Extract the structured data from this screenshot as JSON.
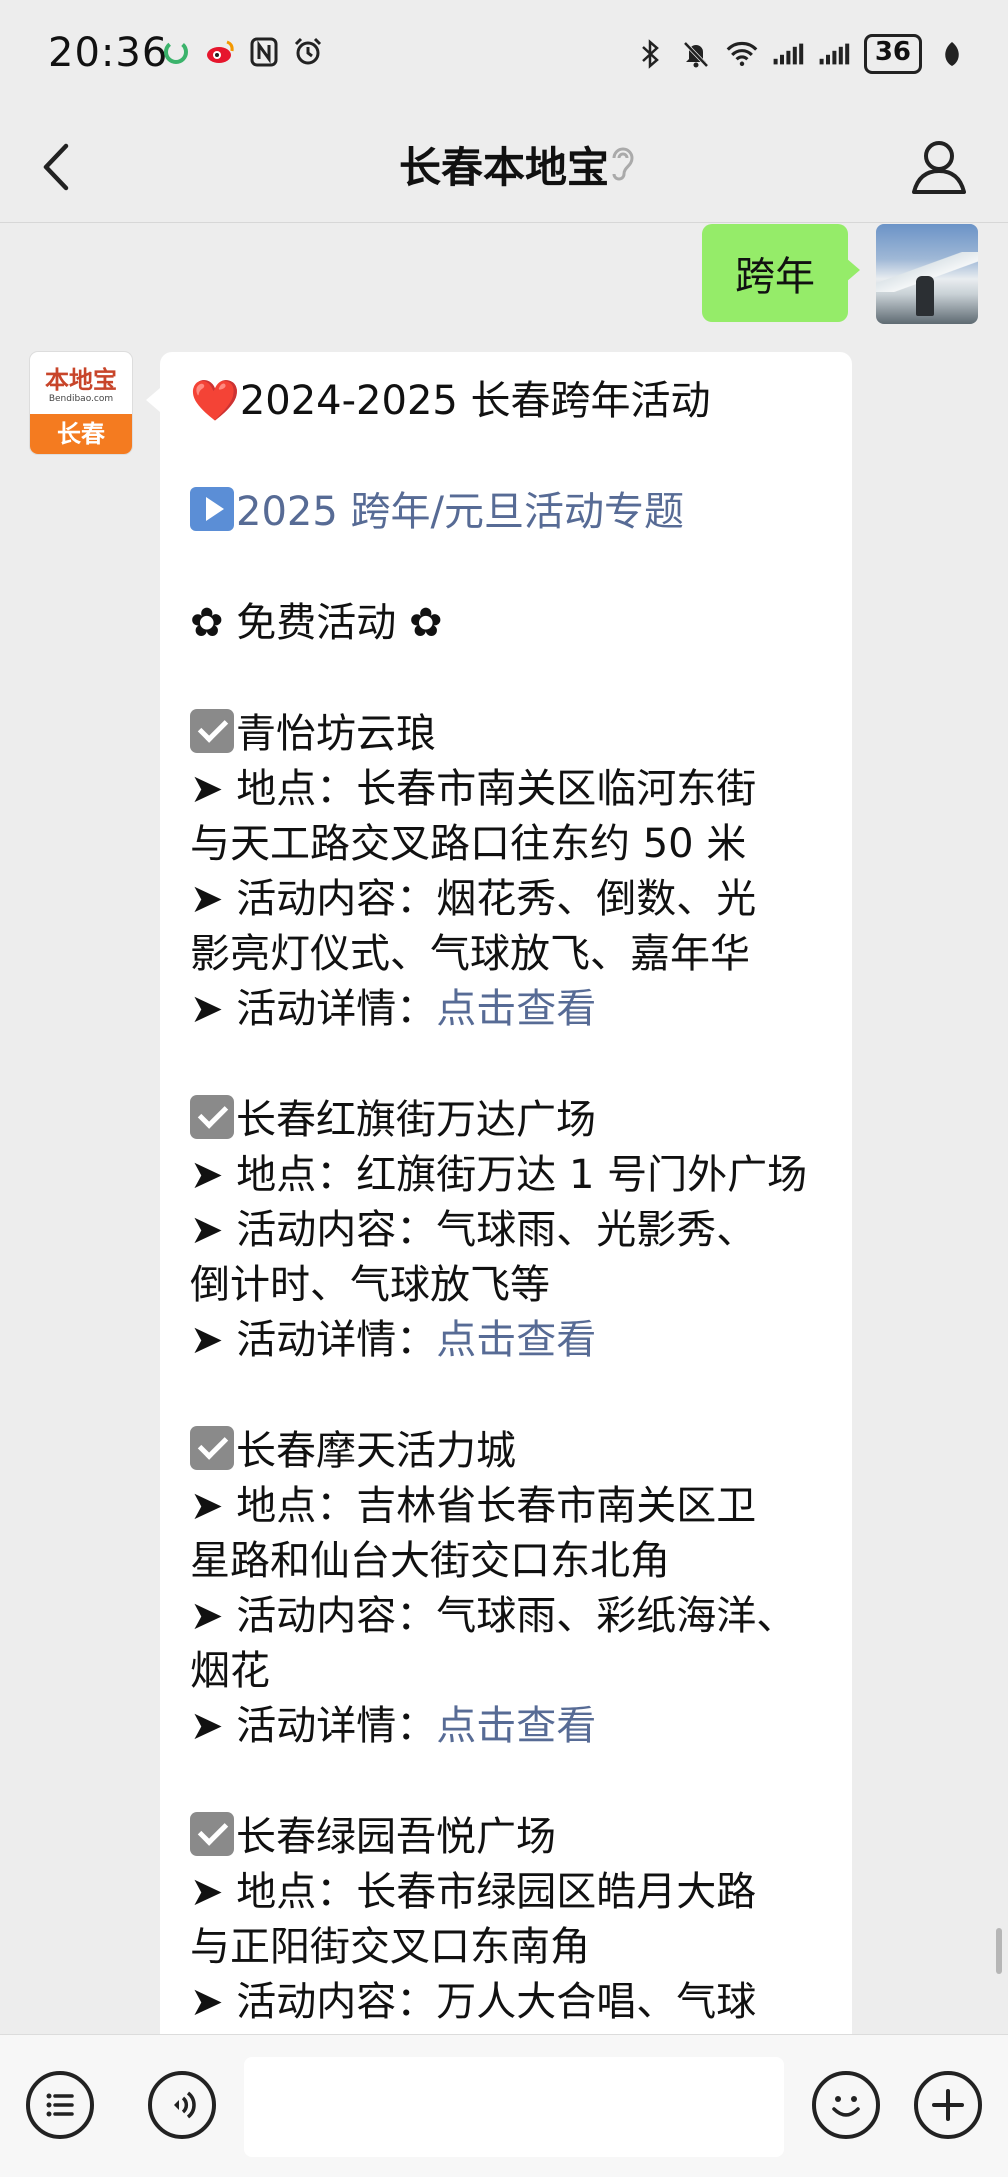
{
  "status_bar": {
    "time": "20:36",
    "left_icons": [
      "app-icon",
      "weibo-icon",
      "nfc-icon",
      "alarm-icon"
    ],
    "right_icons": [
      "bluetooth-icon",
      "mute-icon",
      "wifi-icon",
      "signal-icon",
      "signal-icon"
    ],
    "battery": "36"
  },
  "header": {
    "title": "长春本地宝"
  },
  "messages": {
    "outgoing_text": "跨年",
    "incoming": {
      "avatar_brand": "本地宝",
      "avatar_domain": "Bendibao.com",
      "avatar_city": "长春",
      "title": "2024-2025 长春跨年活动",
      "topic_link": "2025 跨年/元旦活动专题",
      "section_heading": "✿ 免费活动 ✿",
      "events": [
        {
          "name": "青怡坊云琅",
          "location_lines": [
            "➤ 地点：长春市南关区临河东街",
            "与天工路交叉路口往东约 50 米"
          ],
          "content_lines": [
            "➤ 活动内容：烟花秀、倒数、光",
            "影亮灯仪式、气球放飞、嘉年华"
          ],
          "detail_label": "➤ 活动详情：",
          "detail_link": "点击查看"
        },
        {
          "name": "长春红旗街万达广场",
          "location_lines": [
            "➤ 地点：红旗街万达 1 号门外广场"
          ],
          "content_lines": [
            "➤ 活动内容：气球雨、光影秀、",
            "倒计时、气球放飞等"
          ],
          "detail_label": "➤ 活动详情：",
          "detail_link": "点击查看"
        },
        {
          "name": "长春摩天活力城",
          "location_lines": [
            "➤ 地点：吉林省长春市南关区卫",
            "星路和仙台大街交口东北角"
          ],
          "content_lines": [
            "➤ 活动内容：气球雨、彩纸海洋、",
            "烟花"
          ],
          "detail_label": "➤ 活动详情：",
          "detail_link": "点击查看"
        },
        {
          "name": "长春绿园吾悦广场",
          "location_lines": [
            "➤ 地点：长春市绿园区皓月大路",
            "与正阳街交叉口东南角"
          ],
          "content_lines": [
            "➤ 活动内容：万人大合唱、气球"
          ]
        }
      ]
    }
  },
  "bottom_bar": {
    "icons": [
      "menu-list-icon",
      "voice-icon",
      "emoji-icon",
      "plus-icon"
    ]
  }
}
